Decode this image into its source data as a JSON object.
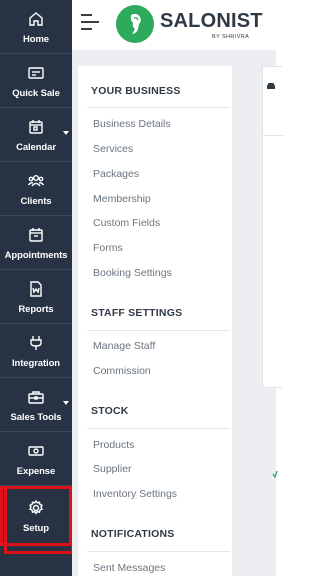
{
  "nav": {
    "items": [
      {
        "label": "Home",
        "icon": "home-icon"
      },
      {
        "label": "Quick Sale",
        "icon": "cash-register-icon"
      },
      {
        "label": "Calendar",
        "icon": "calendar-icon",
        "has_dropdown": true
      },
      {
        "label": "Clients",
        "icon": "users-icon"
      },
      {
        "label": "Appointments",
        "icon": "appointments-calendar-icon"
      },
      {
        "label": "Reports",
        "icon": "report-document-icon"
      },
      {
        "label": "Integration",
        "icon": "plug-icon"
      },
      {
        "label": "Sales Tools",
        "icon": "briefcase-icon",
        "has_dropdown": true
      },
      {
        "label": "Expense",
        "icon": "money-bill-icon"
      },
      {
        "label": "Setup",
        "icon": "gear-icon",
        "highlighted": true
      }
    ]
  },
  "header": {
    "brand": "SALONIST",
    "brand_sub": "BY SHRIVRA"
  },
  "settings": {
    "your_business": {
      "title": "YOUR BUSINESS",
      "links": [
        "Business Details",
        "Services",
        "Packages",
        "Membership",
        "Custom Fields",
        "Forms",
        "Booking Settings"
      ]
    },
    "staff_settings": {
      "title": "STAFF SETTINGS",
      "links": [
        "Manage Staff",
        "Commission"
      ]
    },
    "stock": {
      "title": "STOCK",
      "links": [
        "Products",
        "Supplier",
        "Inventory Settings"
      ]
    },
    "notifications": {
      "title": "NOTIFICATIONS",
      "links": [
        "Sent Messages"
      ]
    }
  },
  "colors": {
    "sidebar_bg": "#273244",
    "brand_green": "#2eaa5c",
    "highlight_red": "#e0101a",
    "content_bg": "#eceef1"
  }
}
